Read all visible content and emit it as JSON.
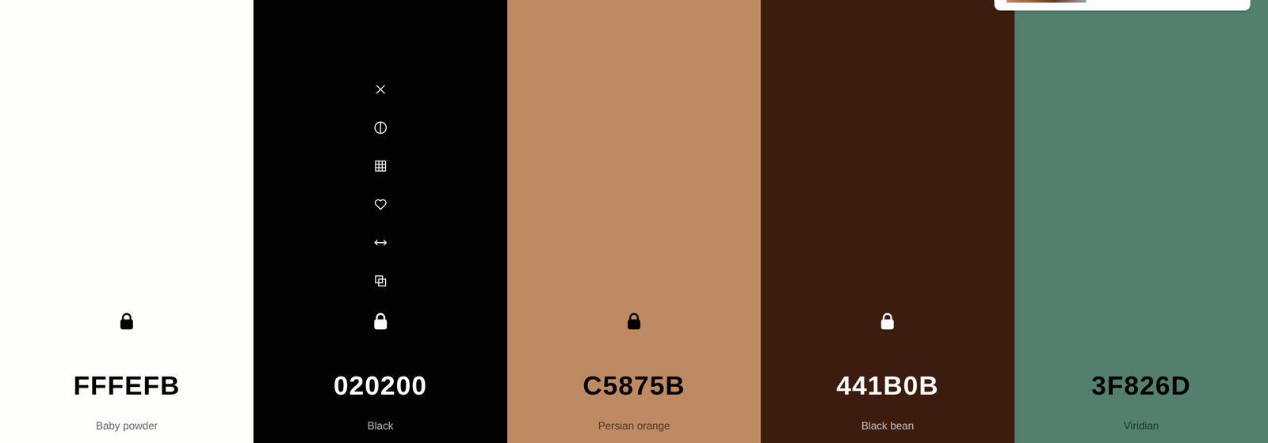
{
  "palette": {
    "columns": [
      {
        "hex": "FFFEFB",
        "name": "Baby powder",
        "color": "#fffefb",
        "locked": true,
        "hovered": false
      },
      {
        "hex": "020200",
        "name": "Black",
        "color": "#020200",
        "locked": true,
        "hovered": true
      },
      {
        "hex": "C5875B",
        "name": "Persian orange",
        "color": "#bd8a63",
        "locked": true,
        "hovered": false
      },
      {
        "hex": "441B0B",
        "name": "Black bean",
        "color": "#3d1c10",
        "locked": true,
        "hovered": false
      },
      {
        "hex": "3F826D",
        "name": "Viridian",
        "color": "#52806d",
        "locked": false,
        "hovered": false
      }
    ]
  }
}
